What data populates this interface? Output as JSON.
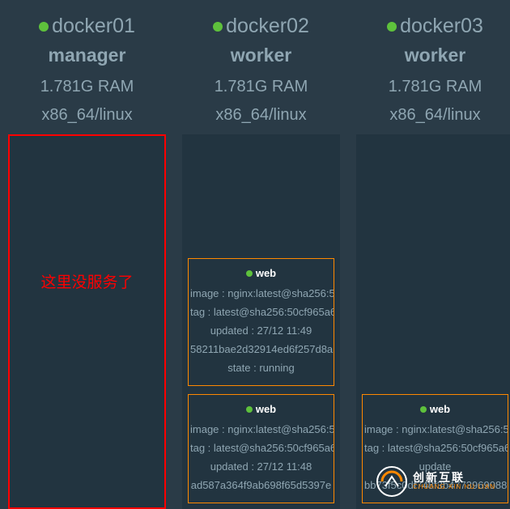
{
  "colors": {
    "bg": "#2a3b47",
    "box_bg": "#223440",
    "accent": "#ff8800",
    "alert": "#ff0000",
    "status_green": "#5ec13c"
  },
  "highlight_text": "这里没服务了",
  "nodes": [
    {
      "status": "green",
      "name": "docker01",
      "role": "manager",
      "ram": "1.781G RAM",
      "arch": "x86_64/linux",
      "highlighted": true,
      "services": []
    },
    {
      "status": "green",
      "name": "docker02",
      "role": "worker",
      "ram": "1.781G RAM",
      "arch": "x86_64/linux",
      "highlighted": false,
      "services": [
        {
          "status": "green",
          "name": "web",
          "image": "image : nginx:latest@sha256:5",
          "tag": "tag : latest@sha256:50cf965a6",
          "updated": "updated : 27/12 11:49",
          "id": "58211bae2d32914ed6f257d8a",
          "state": "state : running"
        },
        {
          "status": "green",
          "name": "web",
          "image": "image : nginx:latest@sha256:5",
          "tag": "tag : latest@sha256:50cf965a6",
          "updated": "updated : 27/12 11:48",
          "id": "ad587a364f9ab698f65d5397e",
          "state": ""
        }
      ]
    },
    {
      "status": "green",
      "name": "docker03",
      "role": "worker",
      "ram": "1.781G RAM",
      "arch": "x86_64/linux",
      "highlighted": false,
      "services": [
        {
          "status": "green",
          "name": "web",
          "image": "image : nginx:latest@sha256:5",
          "tag": "tag : latest@sha256:50cf965a6",
          "updated": "update",
          "id": "bb73f5c0df748f3b47739690880",
          "state": ""
        }
      ]
    }
  ],
  "watermark": {
    "cn": "创新互联",
    "en": "CHUANG XIN HU LIAN"
  }
}
